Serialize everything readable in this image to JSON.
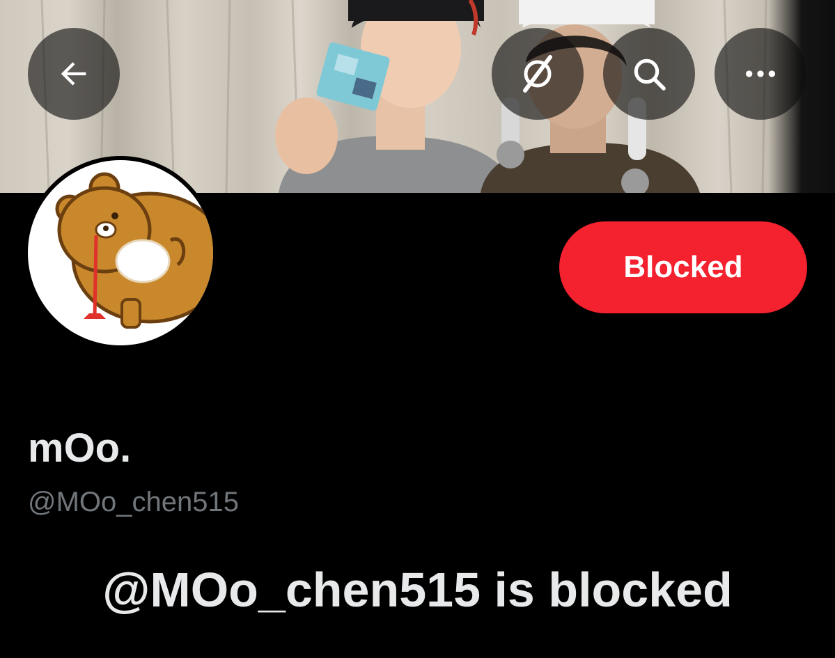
{
  "header": {
    "back_icon": "arrow-left-icon",
    "grok_icon": "grok-slash-icon",
    "search_icon": "search-icon",
    "more_icon": "more-horizontal-icon"
  },
  "banner": {
    "description_icon": "banner-photo"
  },
  "profile": {
    "display_name": "mOo.",
    "handle": "@MOo_chen515",
    "block_button_label": "Blocked",
    "blocked_message": "@MOo_chen515 is blocked"
  },
  "colors": {
    "background": "#000000",
    "blocked_red": "#f4212e",
    "primary_text": "#e7e9ea",
    "secondary_text": "#71767b"
  }
}
